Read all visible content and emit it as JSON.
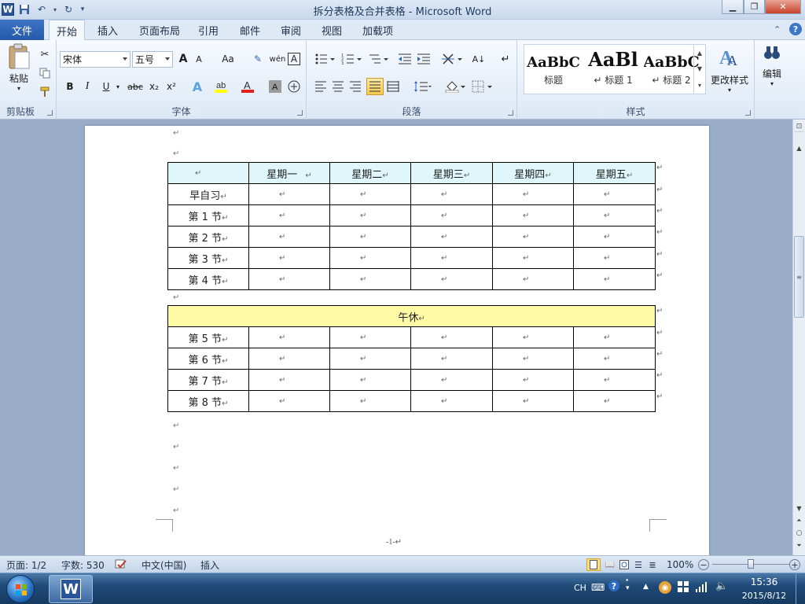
{
  "window": {
    "title": "拆分表格及合并表格 - Microsoft Word",
    "controls": {
      "minimize": "▁",
      "maximize": "❐",
      "close": "✕"
    }
  },
  "tabs": {
    "file": "文件",
    "items": [
      "开始",
      "插入",
      "页面布局",
      "引用",
      "邮件",
      "审阅",
      "视图",
      "加载项"
    ]
  },
  "ribbon": {
    "clipboard": {
      "paste": "粘贴",
      "group": "剪贴板"
    },
    "font": {
      "name": "宋体",
      "size": "五号",
      "group": "字体",
      "grow": "A",
      "shrink": "A",
      "case": "Aa",
      "bold": "B",
      "italic": "I",
      "underline": "U",
      "strike": "abc",
      "sub": "x₂",
      "sup": "x²"
    },
    "paragraph": {
      "group": "段落"
    },
    "styles": {
      "group": "样式",
      "items": [
        {
          "preview": "AaBbC",
          "name": "标题"
        },
        {
          "preview": "AaBl",
          "name": "↵ 标题 1"
        },
        {
          "preview": "AaBbC",
          "name": "↵ 标题 2"
        }
      ],
      "change": "更改样式"
    },
    "editing": {
      "label": "编辑"
    }
  },
  "document": {
    "para_mark": "↵",
    "table1": {
      "header": [
        "",
        "星期一",
        "星期二",
        "星期三",
        "星期四",
        "星期五"
      ],
      "rows": [
        "早自习",
        "第 1 节",
        "第 2 节",
        "第 3 节",
        "第 4 节"
      ]
    },
    "noon_row": "午休",
    "table2": {
      "rows": [
        "第 5 节",
        "第 6 节",
        "第 7 节",
        "第 8 节"
      ]
    },
    "page_number": "-1-"
  },
  "statusbar": {
    "page": "页面: 1/2",
    "words": "字数: 530",
    "language": "中文(中国)",
    "mode": "插入",
    "zoom": "100%"
  },
  "taskbar": {
    "ime": "CH",
    "time": "15:36",
    "date": "2015/8/12"
  }
}
